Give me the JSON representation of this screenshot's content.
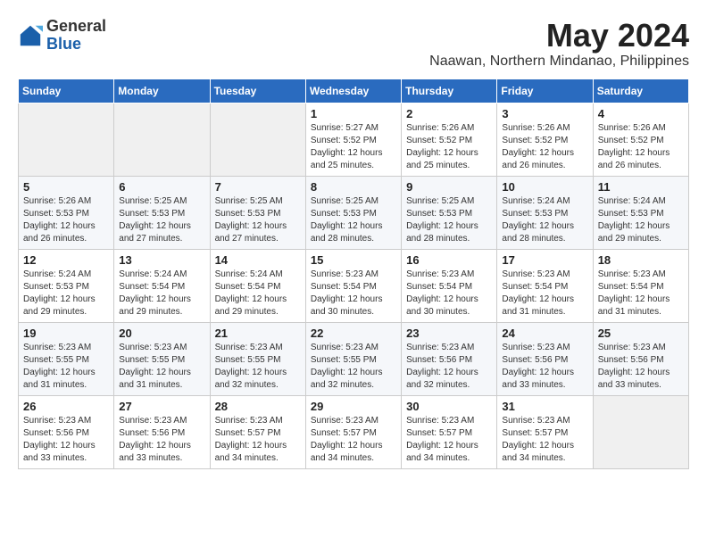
{
  "logo": {
    "general": "General",
    "blue": "Blue"
  },
  "header": {
    "month": "May 2024",
    "location": "Naawan, Northern Mindanao, Philippines"
  },
  "weekdays": [
    "Sunday",
    "Monday",
    "Tuesday",
    "Wednesday",
    "Thursday",
    "Friday",
    "Saturday"
  ],
  "weeks": [
    [
      {
        "day": "",
        "info": ""
      },
      {
        "day": "",
        "info": ""
      },
      {
        "day": "",
        "info": ""
      },
      {
        "day": "1",
        "sunrise": "5:27 AM",
        "sunset": "5:52 PM",
        "daylight": "12 hours and 25 minutes."
      },
      {
        "day": "2",
        "sunrise": "5:26 AM",
        "sunset": "5:52 PM",
        "daylight": "12 hours and 25 minutes."
      },
      {
        "day": "3",
        "sunrise": "5:26 AM",
        "sunset": "5:52 PM",
        "daylight": "12 hours and 26 minutes."
      },
      {
        "day": "4",
        "sunrise": "5:26 AM",
        "sunset": "5:52 PM",
        "daylight": "12 hours and 26 minutes."
      }
    ],
    [
      {
        "day": "5",
        "sunrise": "5:26 AM",
        "sunset": "5:53 PM",
        "daylight": "12 hours and 26 minutes."
      },
      {
        "day": "6",
        "sunrise": "5:25 AM",
        "sunset": "5:53 PM",
        "daylight": "12 hours and 27 minutes."
      },
      {
        "day": "7",
        "sunrise": "5:25 AM",
        "sunset": "5:53 PM",
        "daylight": "12 hours and 27 minutes."
      },
      {
        "day": "8",
        "sunrise": "5:25 AM",
        "sunset": "5:53 PM",
        "daylight": "12 hours and 28 minutes."
      },
      {
        "day": "9",
        "sunrise": "5:25 AM",
        "sunset": "5:53 PM",
        "daylight": "12 hours and 28 minutes."
      },
      {
        "day": "10",
        "sunrise": "5:24 AM",
        "sunset": "5:53 PM",
        "daylight": "12 hours and 28 minutes."
      },
      {
        "day": "11",
        "sunrise": "5:24 AM",
        "sunset": "5:53 PM",
        "daylight": "12 hours and 29 minutes."
      }
    ],
    [
      {
        "day": "12",
        "sunrise": "5:24 AM",
        "sunset": "5:53 PM",
        "daylight": "12 hours and 29 minutes."
      },
      {
        "day": "13",
        "sunrise": "5:24 AM",
        "sunset": "5:54 PM",
        "daylight": "12 hours and 29 minutes."
      },
      {
        "day": "14",
        "sunrise": "5:24 AM",
        "sunset": "5:54 PM",
        "daylight": "12 hours and 29 minutes."
      },
      {
        "day": "15",
        "sunrise": "5:23 AM",
        "sunset": "5:54 PM",
        "daylight": "12 hours and 30 minutes."
      },
      {
        "day": "16",
        "sunrise": "5:23 AM",
        "sunset": "5:54 PM",
        "daylight": "12 hours and 30 minutes."
      },
      {
        "day": "17",
        "sunrise": "5:23 AM",
        "sunset": "5:54 PM",
        "daylight": "12 hours and 31 minutes."
      },
      {
        "day": "18",
        "sunrise": "5:23 AM",
        "sunset": "5:54 PM",
        "daylight": "12 hours and 31 minutes."
      }
    ],
    [
      {
        "day": "19",
        "sunrise": "5:23 AM",
        "sunset": "5:55 PM",
        "daylight": "12 hours and 31 minutes."
      },
      {
        "day": "20",
        "sunrise": "5:23 AM",
        "sunset": "5:55 PM",
        "daylight": "12 hours and 31 minutes."
      },
      {
        "day": "21",
        "sunrise": "5:23 AM",
        "sunset": "5:55 PM",
        "daylight": "12 hours and 32 minutes."
      },
      {
        "day": "22",
        "sunrise": "5:23 AM",
        "sunset": "5:55 PM",
        "daylight": "12 hours and 32 minutes."
      },
      {
        "day": "23",
        "sunrise": "5:23 AM",
        "sunset": "5:56 PM",
        "daylight": "12 hours and 32 minutes."
      },
      {
        "day": "24",
        "sunrise": "5:23 AM",
        "sunset": "5:56 PM",
        "daylight": "12 hours and 33 minutes."
      },
      {
        "day": "25",
        "sunrise": "5:23 AM",
        "sunset": "5:56 PM",
        "daylight": "12 hours and 33 minutes."
      }
    ],
    [
      {
        "day": "26",
        "sunrise": "5:23 AM",
        "sunset": "5:56 PM",
        "daylight": "12 hours and 33 minutes."
      },
      {
        "day": "27",
        "sunrise": "5:23 AM",
        "sunset": "5:56 PM",
        "daylight": "12 hours and 33 minutes."
      },
      {
        "day": "28",
        "sunrise": "5:23 AM",
        "sunset": "5:57 PM",
        "daylight": "12 hours and 34 minutes."
      },
      {
        "day": "29",
        "sunrise": "5:23 AM",
        "sunset": "5:57 PM",
        "daylight": "12 hours and 34 minutes."
      },
      {
        "day": "30",
        "sunrise": "5:23 AM",
        "sunset": "5:57 PM",
        "daylight": "12 hours and 34 minutes."
      },
      {
        "day": "31",
        "sunrise": "5:23 AM",
        "sunset": "5:57 PM",
        "daylight": "12 hours and 34 minutes."
      },
      {
        "day": "",
        "info": ""
      }
    ]
  ]
}
